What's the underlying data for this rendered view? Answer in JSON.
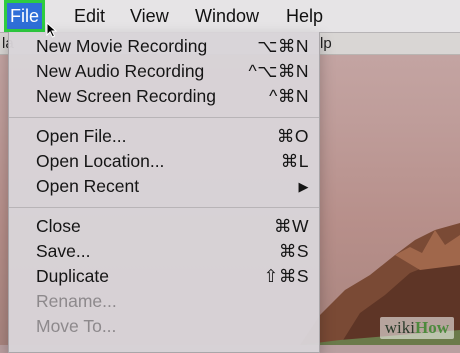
{
  "menubar": {
    "items": [
      "File",
      "Edit",
      "View",
      "Window",
      "Help"
    ],
    "active": "File"
  },
  "background_window": {
    "left_fragment": "la",
    "right_fragment": "lp"
  },
  "file_menu": {
    "items": [
      {
        "label": "New Movie Recording",
        "shortcut": "⌥⌘N",
        "enabled": true
      },
      {
        "label": "New Audio Recording",
        "shortcut": "^⌥⌘N",
        "enabled": true
      },
      {
        "label": "New Screen Recording",
        "shortcut": "^⌘N",
        "enabled": true
      },
      {
        "label": "Open File...",
        "shortcut": "⌘O",
        "enabled": true
      },
      {
        "label": "Open Location...",
        "shortcut": "⌘L",
        "enabled": true
      },
      {
        "label": "Open Recent",
        "shortcut": "▶",
        "enabled": true
      },
      {
        "label": "Close",
        "shortcut": "⌘W",
        "enabled": true
      },
      {
        "label": "Save...",
        "shortcut": "⌘S",
        "enabled": true
      },
      {
        "label": "Duplicate",
        "shortcut": "⇧⌘S",
        "enabled": true
      },
      {
        "label": "Rename...",
        "shortcut": "",
        "enabled": false
      },
      {
        "label": "Move To...",
        "shortcut": "",
        "enabled": false
      }
    ]
  },
  "watermark": {
    "prefix": "wiki",
    "suffix": "How"
  },
  "colors": {
    "menu_highlight": "#2f6fd8",
    "highlight_outline": "#2ecc40",
    "disabled_text": "#8d898c"
  }
}
